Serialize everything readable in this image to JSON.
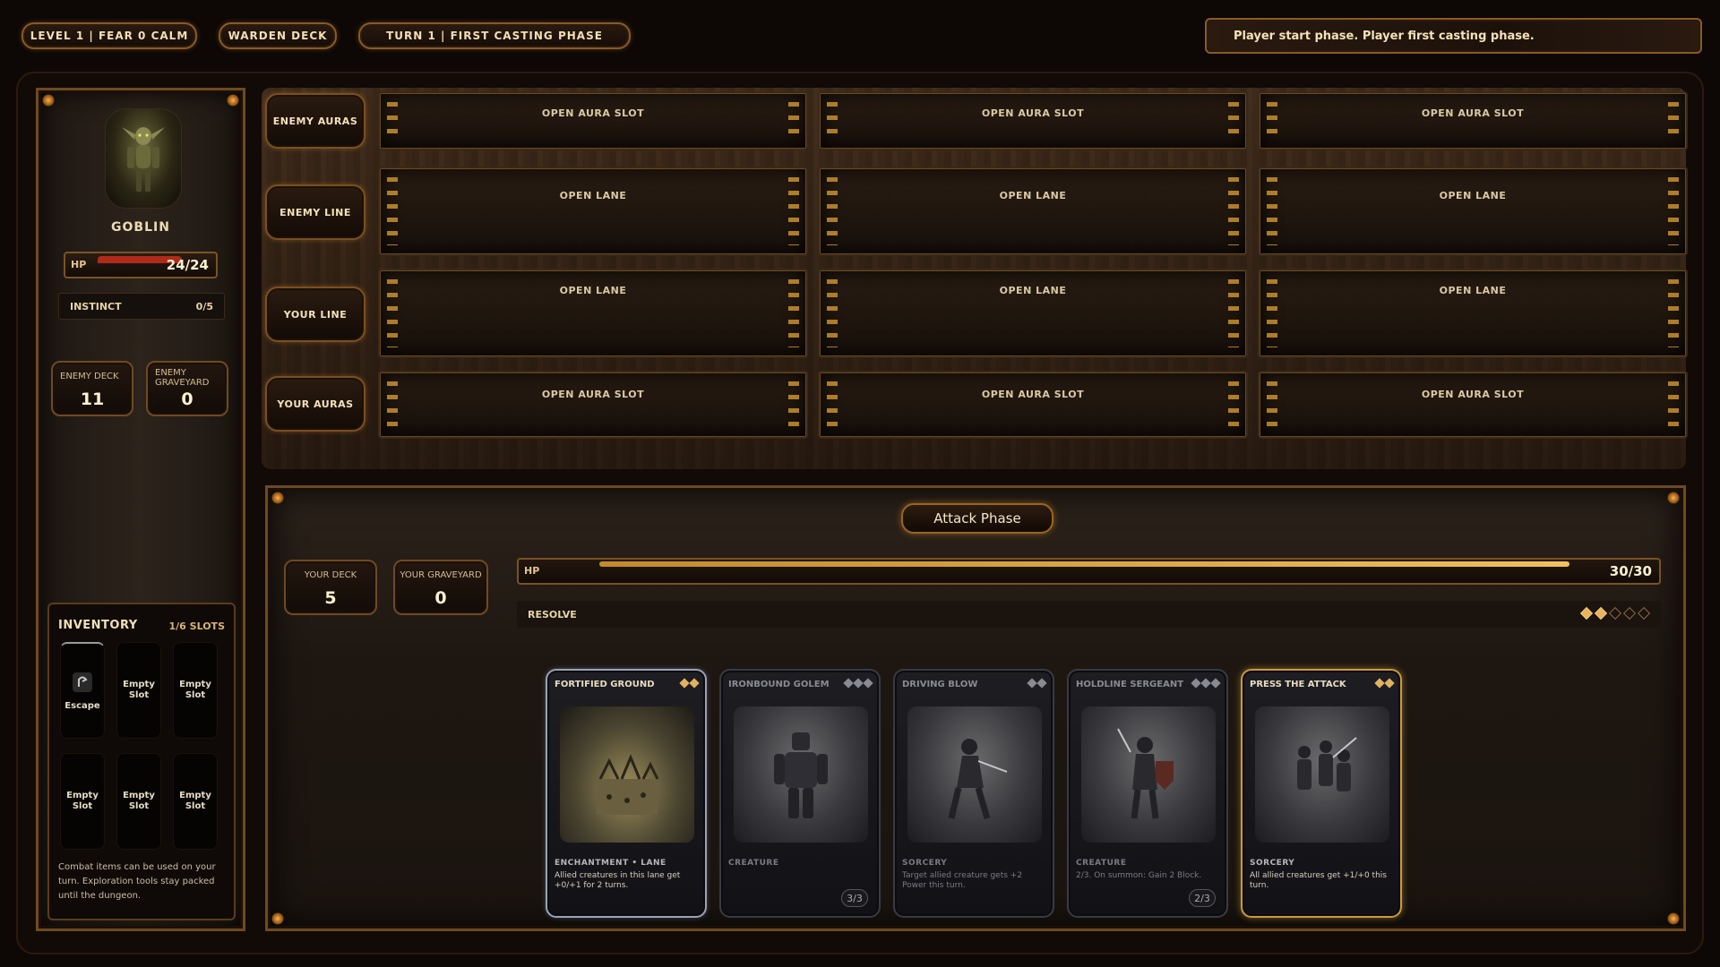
{
  "top_bar": {
    "level_fear": "LEVEL 1 | FEAR 0 CALM",
    "deck_name": "WARDEN DECK",
    "turn_phase": "TURN 1 | FIRST CASTING PHASE",
    "log": "Player start phase. Player first casting phase."
  },
  "enemy": {
    "name": "GOBLIN",
    "hp_label": "HP",
    "hp": "24/24",
    "hp_fraction": 1.0,
    "instinct_label": "INSTINCT",
    "instinct_value": "0/5",
    "deck_label": "ENEMY DECK",
    "deck_count": "11",
    "graveyard_label": "ENEMY GRAVEYARD",
    "graveyard_count": "0"
  },
  "inventory": {
    "title": "INVENTORY",
    "slots_text": "1/6 SLOTS",
    "items": [
      {
        "label": "Escape",
        "filled": true
      },
      {
        "label": "Empty Slot",
        "filled": false
      },
      {
        "label": "Empty Slot",
        "filled": false
      },
      {
        "label": "Empty Slot",
        "filled": false
      },
      {
        "label": "Empty Slot",
        "filled": false
      },
      {
        "label": "Empty Slot",
        "filled": false
      }
    ],
    "note": "Combat items can be used on your turn. Exploration tools stay packed until the dungeon."
  },
  "board": {
    "rows": [
      {
        "label": "ENEMY AURAS",
        "slots": [
          "OPEN AURA SLOT",
          "OPEN AURA SLOT",
          "OPEN AURA SLOT"
        ]
      },
      {
        "label": "ENEMY LINE",
        "slots": [
          "OPEN LANE",
          "OPEN LANE",
          "OPEN LANE"
        ]
      },
      {
        "label": "YOUR LINE",
        "slots": [
          "OPEN LANE",
          "OPEN LANE",
          "OPEN LANE"
        ]
      },
      {
        "label": "YOUR AURAS",
        "slots": [
          "OPEN AURA SLOT",
          "OPEN AURA SLOT",
          "OPEN AURA SLOT"
        ]
      }
    ]
  },
  "player": {
    "phase_button": "Attack Phase",
    "deck_label": "YOUR DECK",
    "deck_count": "5",
    "graveyard_label": "YOUR GRAVEYARD",
    "graveyard_count": "0",
    "hp_label": "HP",
    "hp": "30/30",
    "hp_fraction": 1.0,
    "resolve_label": "RESOLVE",
    "resolve_filled": 2,
    "resolve_max": 5
  },
  "hand": [
    {
      "name": "FORTIFIED GROUND",
      "cost": 2,
      "type": "ENCHANTMENT • LANE",
      "text": "Allied creatures in this lane get +0/+1 for 2 turns.",
      "pt": "",
      "style": "silver"
    },
    {
      "name": "IRONBOUND GOLEM",
      "cost": 3,
      "type": "CREATURE",
      "text": "",
      "pt": "3/3",
      "style": "dim"
    },
    {
      "name": "DRIVING BLOW",
      "cost": 2,
      "type": "SORCERY",
      "text": "Target allied creature gets +2 Power this turn.",
      "pt": "",
      "style": "dim"
    },
    {
      "name": "HOLDLINE SERGEANT",
      "cost": 3,
      "type": "CREATURE",
      "text": "2/3. On summon: Gain 2 Block.",
      "pt": "2/3",
      "style": "dim"
    },
    {
      "name": "PRESS THE ATTACK",
      "cost": 2,
      "type": "SORCERY",
      "text": "All allied creatures get +1/+0 this turn.",
      "pt": "",
      "style": "gold"
    }
  ],
  "colors": {
    "accent_gold": "#c89a40",
    "hp_red": "#b02a1a",
    "frame_bronze": "#6e4a22"
  }
}
